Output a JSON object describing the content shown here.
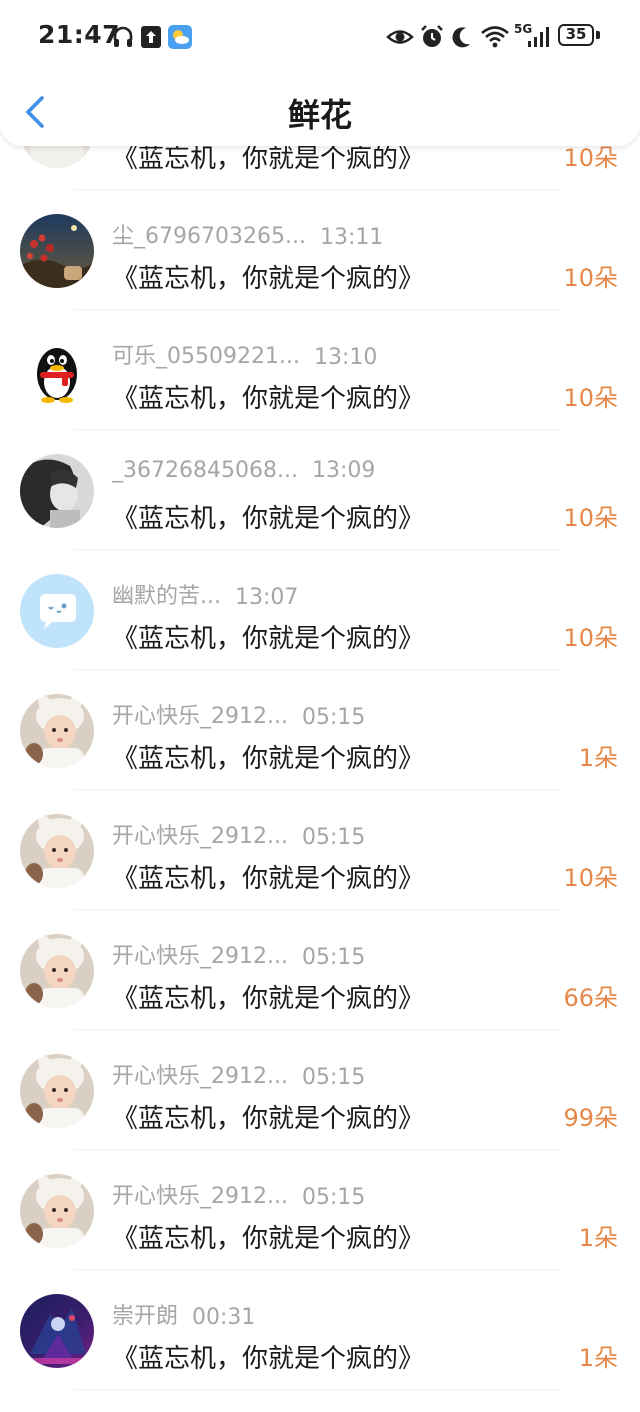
{
  "status_bar": {
    "time": "21:47",
    "network": "5G",
    "battery": "35",
    "icons": [
      "headphones-icon",
      "upload-icon",
      "weather-icon",
      "eye-icon",
      "alarm-icon",
      "moon-icon",
      "wifi-icon",
      "signal-icon",
      "battery-icon"
    ]
  },
  "header": {
    "title": "鲜花",
    "back_icon": "chevron-left-icon"
  },
  "colors": {
    "accent_blue": "#3a8ee6",
    "flower_orange": "#e5884a",
    "meta_gray": "#a6a6a6"
  },
  "list": [
    {
      "user": "",
      "time": "",
      "message": "《蓝忘机，你就是个疯的》",
      "flowers": "10朵",
      "avatar": "partial-avatar"
    },
    {
      "user": "尘_6796703265...",
      "time": "13:11",
      "message": "《蓝忘机，你就是个疯的》",
      "flowers": "10朵",
      "avatar": "night-flowers-avatar"
    },
    {
      "user": "可乐_05509221...",
      "time": "13:10",
      "message": "《蓝忘机，你就是个疯的》",
      "flowers": "10朵",
      "avatar": "penguin-avatar"
    },
    {
      "user": "_36726845068...",
      "time": "13:09",
      "message": "《蓝忘机，你就是个疯的》",
      "flowers": "10朵",
      "avatar": "grayscale-portrait-avatar"
    },
    {
      "user": "幽默的苦...",
      "time": "13:07",
      "message": "《蓝忘机，你就是个疯的》",
      "flowers": "10朵",
      "avatar": "chat-bubble-avatar"
    },
    {
      "user": "开心快乐_2912...",
      "time": "05:15",
      "message": "《蓝忘机，你就是个疯的》",
      "flowers": "1朵",
      "avatar": "baby-avatar"
    },
    {
      "user": "开心快乐_2912...",
      "time": "05:15",
      "message": "《蓝忘机，你就是个疯的》",
      "flowers": "10朵",
      "avatar": "baby-avatar"
    },
    {
      "user": "开心快乐_2912...",
      "time": "05:15",
      "message": "《蓝忘机，你就是个疯的》",
      "flowers": "66朵",
      "avatar": "baby-avatar"
    },
    {
      "user": "开心快乐_2912...",
      "time": "05:15",
      "message": "《蓝忘机，你就是个疯的》",
      "flowers": "99朵",
      "avatar": "baby-avatar"
    },
    {
      "user": "开心快乐_2912...",
      "time": "05:15",
      "message": "《蓝忘机，你就是个疯的》",
      "flowers": "1朵",
      "avatar": "baby-avatar"
    },
    {
      "user": "崇开朗",
      "time": "00:31",
      "message": "《蓝忘机，你就是个疯的》",
      "flowers": "1朵",
      "avatar": "game-character-avatar"
    }
  ]
}
